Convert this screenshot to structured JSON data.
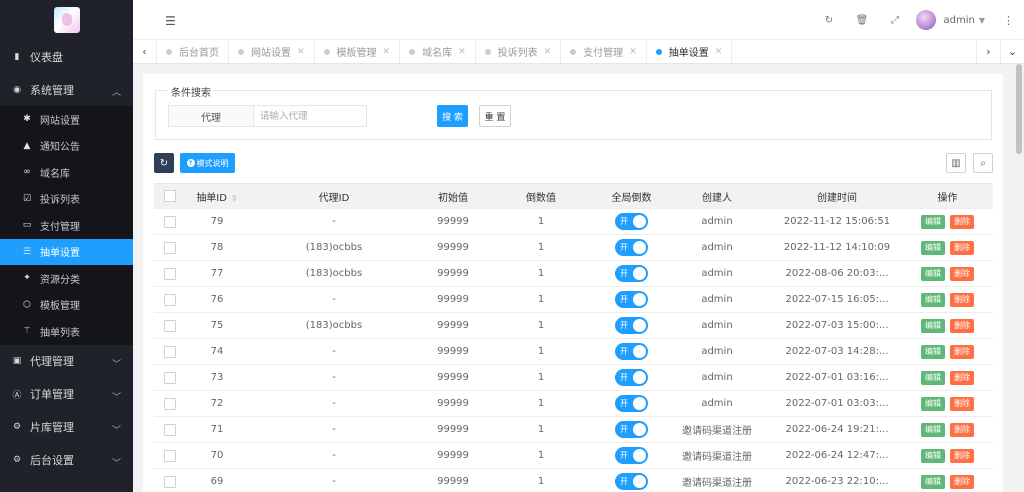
{
  "sidebar": {
    "items": [
      {
        "label": "仪表盘",
        "icon": "dashboard-icon"
      },
      {
        "label": "系统管理",
        "icon": "settings-circle-icon",
        "expanded": true,
        "children": [
          {
            "label": "网站设置",
            "icon": "gear-icon"
          },
          {
            "label": "通知公告",
            "icon": "bell-icon"
          },
          {
            "label": "域名库",
            "icon": "link-icon"
          },
          {
            "label": "投诉列表",
            "icon": "checkbox-icon"
          },
          {
            "label": "支付管理",
            "icon": "card-icon"
          },
          {
            "label": "抽单设置",
            "icon": "sliders-icon",
            "active": true
          },
          {
            "label": "资源分类",
            "icon": "tags-icon"
          },
          {
            "label": "模板管理",
            "icon": "html-icon"
          },
          {
            "label": "抽单列表",
            "icon": "wand-icon"
          }
        ]
      },
      {
        "label": "代理管理",
        "icon": "user-card-icon"
      },
      {
        "label": "订单管理",
        "icon": "font-box-icon"
      },
      {
        "label": "片库管理",
        "icon": "film-gear-icon"
      },
      {
        "label": "后台设置",
        "icon": "cogs-icon"
      }
    ]
  },
  "topbar": {
    "username": "admin"
  },
  "tabs": [
    {
      "label": "后台首页",
      "closable": false
    },
    {
      "label": "网站设置",
      "closable": true
    },
    {
      "label": "模板管理",
      "closable": true
    },
    {
      "label": "域名库",
      "closable": true
    },
    {
      "label": "投诉列表",
      "closable": true
    },
    {
      "label": "支付管理",
      "closable": true
    },
    {
      "label": "抽单设置",
      "closable": true,
      "active": true
    }
  ],
  "search": {
    "legend": "条件搜索",
    "field_label": "代理",
    "placeholder": "请输入代理",
    "search_button": "搜 索",
    "reset_button": "重 置"
  },
  "toolbar": {
    "help_label": "模式说明"
  },
  "table": {
    "columns": [
      "抽单ID",
      "代理ID",
      "初始值",
      "倒数值",
      "全局倒数",
      "创建人",
      "创建时间",
      "操作"
    ],
    "toggle_on_label": "开",
    "edit_label": "编辑",
    "delete_label": "删除",
    "rows": [
      {
        "id": "79",
        "agent": "-",
        "initial": "99999",
        "countdown": "1",
        "creator": "admin",
        "time": "2022-11-12 15:06:51"
      },
      {
        "id": "78",
        "agent": "(183)ocbbs",
        "initial": "99999",
        "countdown": "1",
        "creator": "admin",
        "time": "2022-11-12 14:10:09"
      },
      {
        "id": "77",
        "agent": "(183)ocbbs",
        "initial": "99999",
        "countdown": "1",
        "creator": "admin",
        "time": "2022-08-06 20:03:..."
      },
      {
        "id": "76",
        "agent": "-",
        "initial": "99999",
        "countdown": "1",
        "creator": "admin",
        "time": "2022-07-15 16:05:..."
      },
      {
        "id": "75",
        "agent": "(183)ocbbs",
        "initial": "99999",
        "countdown": "1",
        "creator": "admin",
        "time": "2022-07-03 15:00:..."
      },
      {
        "id": "74",
        "agent": "-",
        "initial": "99999",
        "countdown": "1",
        "creator": "admin",
        "time": "2022-07-03 14:28:..."
      },
      {
        "id": "73",
        "agent": "-",
        "initial": "99999",
        "countdown": "1",
        "creator": "admin",
        "time": "2022-07-01 03:16:..."
      },
      {
        "id": "72",
        "agent": "-",
        "initial": "99999",
        "countdown": "1",
        "creator": "admin",
        "time": "2022-07-01 03:03:..."
      },
      {
        "id": "71",
        "agent": "-",
        "initial": "99999",
        "countdown": "1",
        "creator": "邀请码渠道注册",
        "time": "2022-06-24 19:21:..."
      },
      {
        "id": "70",
        "agent": "-",
        "initial": "99999",
        "countdown": "1",
        "creator": "邀请码渠道注册",
        "time": "2022-06-24 12:47:..."
      },
      {
        "id": "69",
        "agent": "-",
        "initial": "99999",
        "countdown": "1",
        "creator": "邀请码渠道注册",
        "time": "2022-06-23 22:10:..."
      }
    ]
  },
  "colors": {
    "accent": "#1e9fff",
    "sidebar_bg": "#20222a",
    "edit": "#5fb878",
    "delete": "#ff5722"
  }
}
